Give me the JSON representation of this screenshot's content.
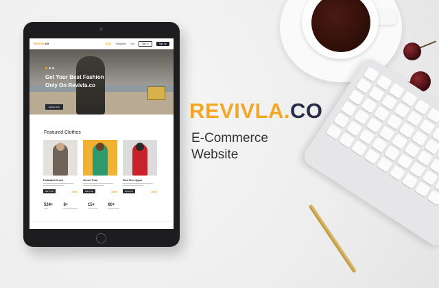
{
  "brand": {
    "part1": "REVIVLA.",
    "part2": "CO",
    "subtitle_line1": "E-Commerce",
    "subtitle_line2": "Website"
  },
  "site": {
    "logo_main": "Revivla",
    "logo_suffix": ".co",
    "nav_links": [
      "Home",
      "Categories",
      "Cart"
    ],
    "signin": "Sign In",
    "signup": "Sign Up",
    "hero_headline": "Get Your Best Fashion Only On Revivla.co",
    "hero_cta": "Explore Now",
    "featured_title": "Featured Clothes",
    "products": [
      {
        "name": "Polkadot Dress",
        "price": "300k",
        "buy": "Add to Cart",
        "bg": "#e4e0dc",
        "figure": "#6f6458"
      },
      {
        "name": "Green Polo",
        "price": "300k",
        "buy": "Add to Cart",
        "bg": "#f3b132",
        "figure": "#2e9a6c"
      },
      {
        "name": "Red Fire Upper",
        "price": "300k",
        "buy": "Add to Cart",
        "bg": "#dcdcdc",
        "figure": "#c8232a"
      }
    ],
    "stats": [
      {
        "num": "524+",
        "label": "Users"
      },
      {
        "num": "8+",
        "label": "Product Categories"
      },
      {
        "num": "15+",
        "label": "Cities of Java"
      },
      {
        "num": "60+",
        "label": "Brands Member"
      }
    ]
  },
  "colors": {
    "accent": "#f5a623",
    "navy": "#2b2d48"
  }
}
